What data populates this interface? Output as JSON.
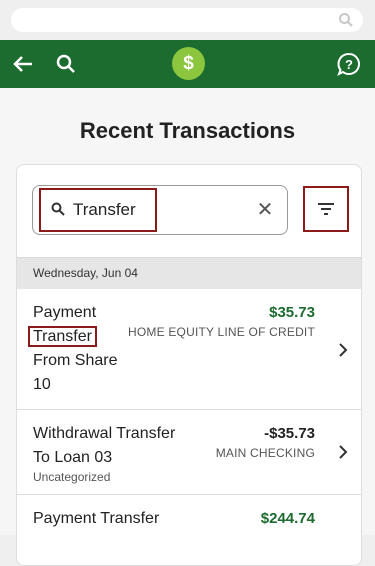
{
  "page": {
    "title": "Recent Transactions"
  },
  "search": {
    "value": "Transfer"
  },
  "date_header": "Wednesday, Jun 04",
  "transactions": [
    {
      "desc_line1": "Payment",
      "desc_line2_boxed": "Transfer",
      "desc_line3": "From Share",
      "desc_line4": "10",
      "amount": "$35.73",
      "account": "HOME EQUITY LINE OF CREDIT",
      "category": ""
    },
    {
      "desc_line1": "Withdrawal Transfer",
      "desc_line2": "To Loan 03",
      "amount": "-$35.73",
      "account": "MAIN CHECKING",
      "category": "Uncategorized"
    },
    {
      "desc_line1": "Payment Transfer",
      "amount": "$244.74"
    }
  ],
  "colors": {
    "brand": "#1c6b2f",
    "logo": "#8cc63f",
    "highlight": "#8b1a1a",
    "positive": "#1c6b2f"
  },
  "icons": [
    "search-icon",
    "back-arrow-icon",
    "dollar-logo-icon",
    "help-chat-icon",
    "clear-icon",
    "filter-icon",
    "chevron-right-icon"
  ]
}
